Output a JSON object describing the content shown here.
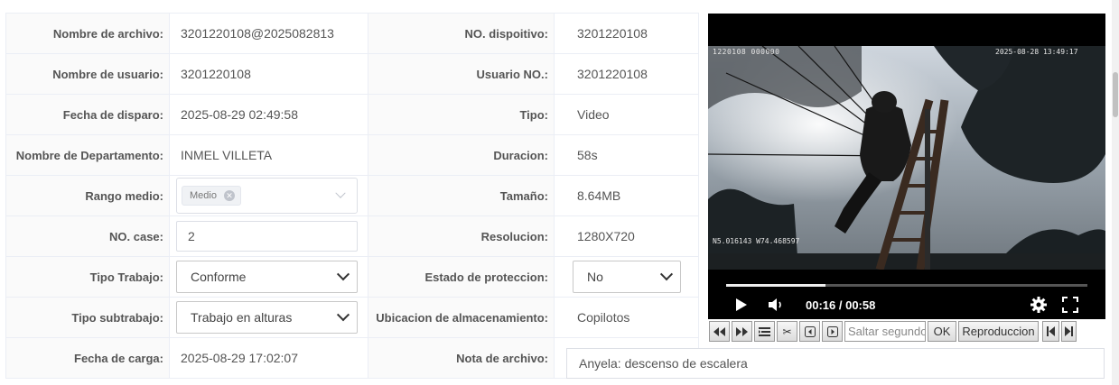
{
  "fields": {
    "nombre_archivo": {
      "label": "Nombre de archivo:",
      "value": "3201220108@2025082813"
    },
    "no_dispositivo": {
      "label": "NO. dispoitivo:",
      "value": "3201220108"
    },
    "nombre_usuario": {
      "label": "Nombre de usuario:",
      "value": "3201220108"
    },
    "usuario_no": {
      "label": "Usuario NO.:",
      "value": "3201220108"
    },
    "fecha_disparo": {
      "label": "Fecha de disparo:",
      "value": "2025-08-29 02:49:58"
    },
    "tipo": {
      "label": "Tipo:",
      "value": "Video"
    },
    "nombre_departamento": {
      "label": "Nombre de Departamento:",
      "value": "INMEL VILLETA"
    },
    "duracion": {
      "label": "Duracion:",
      "value": "58s"
    },
    "rango_medio": {
      "label": "Rango medio:",
      "tag": "Medio"
    },
    "tamano": {
      "label": "Tamaño:",
      "value": "8.64MB"
    },
    "no_case": {
      "label": "NO. case:",
      "value": "2"
    },
    "resolucion": {
      "label": "Resolucion:",
      "value": "1280X720"
    },
    "tipo_trabajo": {
      "label": "Tipo Trabajo:",
      "value": "Conforme"
    },
    "estado_proteccion": {
      "label": "Estado de proteccion:",
      "value": "No"
    },
    "tipo_subtrabajo": {
      "label": "Tipo subtrabajo:",
      "value": "Trabajo en alturas"
    },
    "ubicacion_almacenamiento": {
      "label": "Ubicacion de almacenamiento:",
      "value": "Copilotos"
    },
    "fecha_carga": {
      "label": "Fecha de carga:",
      "value": "2025-08-29 17:02:07"
    },
    "nota_archivo": {
      "label": "Nota de archivo:",
      "value": "Anyela: descenso de escalera"
    }
  },
  "player": {
    "osd_device": "1220108 000000",
    "osd_datetime": "2025-08-28  13:49:17",
    "osd_gps": "N5.016143  W74.468597",
    "time_display": "00:16 / 00:58",
    "progress_fraction": 0.276
  },
  "toolbar": {
    "skip_placeholder": "Saltar segundos",
    "ok_label": "OK",
    "playback_label": "Reproduccion"
  },
  "icons": [
    "rewind-icon",
    "fast-forward-icon",
    "list-icon",
    "scissors-icon",
    "frame-back-icon",
    "frame-forward-icon",
    "skip-start-icon",
    "skip-end-icon",
    "play-icon",
    "volume-icon",
    "settings-gear-icon",
    "fullscreen-icon",
    "close-tag-icon",
    "chevron-down-icon"
  ]
}
